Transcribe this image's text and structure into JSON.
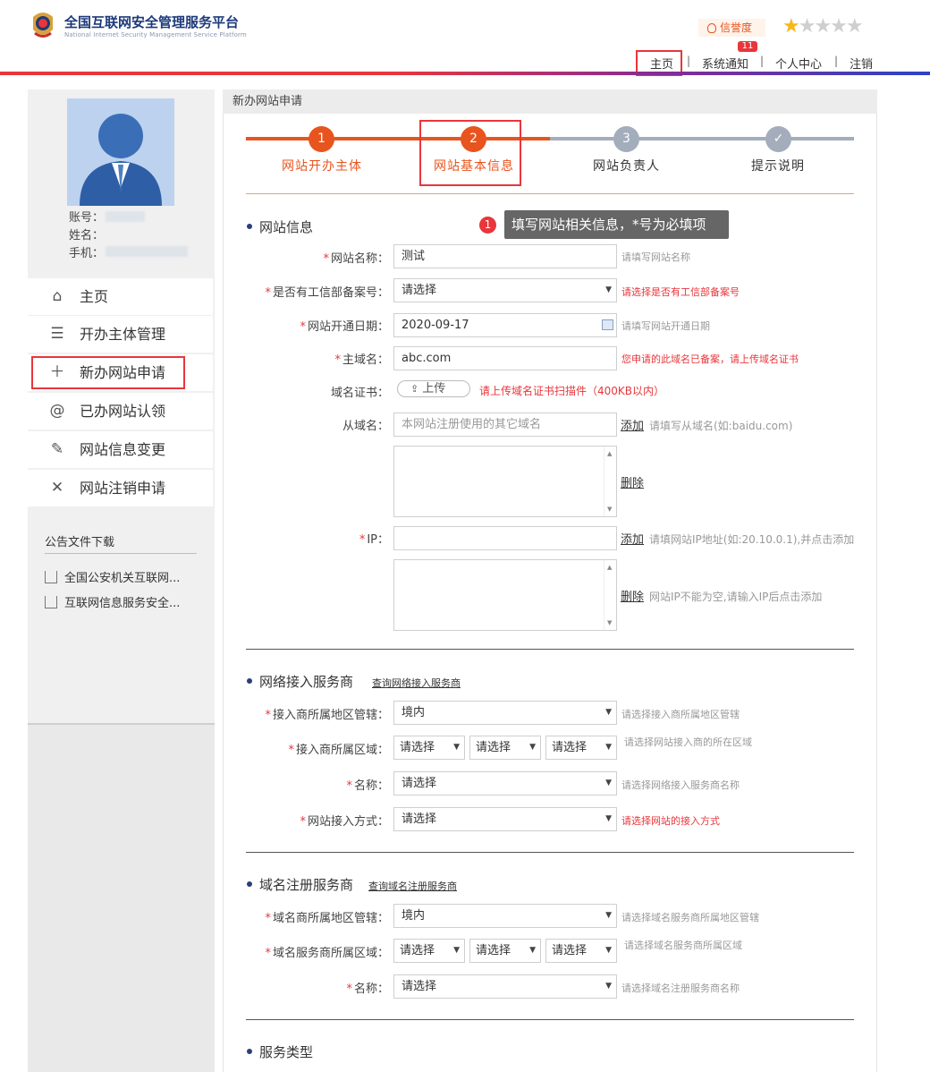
{
  "header": {
    "title": "全国互联网安全管理服务平台",
    "subtitle": "National Internet Security Management Service Platform",
    "credit_label": "信誉度",
    "stars_on": "★",
    "stars_off": "★★★★",
    "rating": "1/5",
    "notify_count": "11",
    "nav": [
      "主页",
      "系统通知",
      "个人中心",
      "注销"
    ],
    "separator": "|"
  },
  "sidebar": {
    "account_label": "账号：",
    "name_label": "姓名：",
    "phone_label": "手机：",
    "menu": [
      "主页",
      "开办主体管理",
      "新办网站申请",
      "已办网站认领",
      "网站信息变更",
      "网站注销申请"
    ],
    "downloads_title": "公告文件下载",
    "downloads": [
      "全国公安机关互联网...",
      "互联网信息服务安全..."
    ]
  },
  "main": {
    "breadcrumb": "新办网站申请",
    "steps": [
      {
        "num": "1",
        "label": "网站开办主体"
      },
      {
        "num": "2",
        "label": "网站基本信息"
      },
      {
        "num": "3",
        "label": "网站负责人"
      },
      {
        "num": "✓",
        "label": "提示说明"
      }
    ],
    "tooltip_num": "1",
    "tooltip": "填写网站相关信息，*号为必填项",
    "site_section": {
      "title": "网站信息",
      "name_label": "网站名称：",
      "name_value": "测试",
      "name_hint": "请填写网站名称",
      "icp_label": "是否有工信部备案号：",
      "icp_value": "请选择",
      "icp_hint": "请选择是否有工信部备案号",
      "date_label": "网站开通日期：",
      "date_value": "2020-09-17",
      "date_hint": "请填写网站开通日期",
      "domain_label": "主域名：",
      "domain_value": "abc.com",
      "domain_hint": "您申请的此域名已备案，请上传域名证书",
      "cert_label": "域名证书：",
      "upload_label": "上传",
      "cert_hint": "请上传域名证书扫描件（400KB以内）",
      "subdomain_label": "从域名：",
      "subdomain_placeholder": "本网站注册使用的其它域名",
      "add_label": "添加",
      "subdomain_hint": "请填写从域名(如:baidu.com)",
      "delete_label": "删除",
      "ip_label": "IP：",
      "ip_hint": "请填网站IP地址(如:20.10.0.1),并点击添加",
      "ip_delete_hint": "网站IP不能为空,请输入IP后点击添加"
    },
    "isp_section": {
      "title": "网络接入服务商",
      "link": "查询网络接入服务商",
      "region_label": "接入商所属地区管辖：",
      "region_value": "境内",
      "region_hint": "请选择接入商所属地区管辖",
      "area_label": "接入商所属区域：",
      "area_values": [
        "请选择",
        "请选择",
        "请选择"
      ],
      "area_hint": "请选择网站接入商的所在区域",
      "name_label": "名称：",
      "name_value": "请选择",
      "name_hint": "请选择网络接入服务商名称",
      "mode_label": "网站接入方式：",
      "mode_value": "请选择",
      "mode_hint": "请选择网站的接入方式"
    },
    "registrar_section": {
      "title": "域名注册服务商",
      "link": "查询域名注册服务商",
      "region_label": "域名商所属地区管辖：",
      "region_value": "境内",
      "region_hint": "请选择域名服务商所属地区管辖",
      "area_label": "域名服务商所属区域：",
      "area_values": [
        "请选择",
        "请选择",
        "请选择"
      ],
      "area_hint": "请选择域名服务商所属区域",
      "name_label": "名称：",
      "name_value": "请选择",
      "name_hint": "请选择域名注册服务商名称"
    },
    "service_section": {
      "title": "服务类型"
    }
  },
  "colors": {
    "accent": "#e8541e",
    "step_done": "#e8541e",
    "step_todo": "#a3adbb",
    "highlight_box": "#e8363b"
  }
}
